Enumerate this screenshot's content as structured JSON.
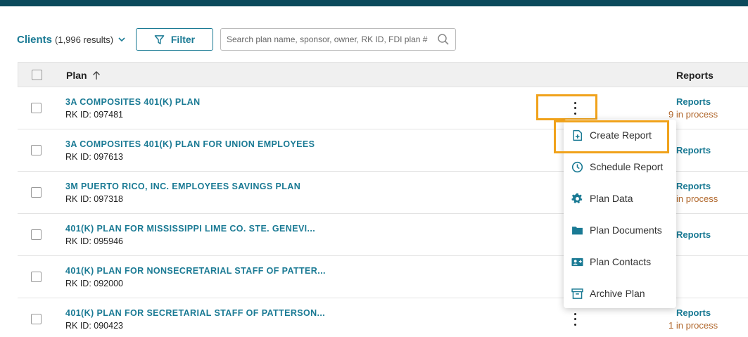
{
  "toolbar": {
    "clients_label": "Clients",
    "clients_count": "(1,996 results)",
    "filter_label": "Filter",
    "search_placeholder": "Search plan name, sponsor, owner, RK ID, FDI plan #",
    "search_value": ""
  },
  "table": {
    "columns": {
      "plan": "Plan",
      "reports": "Reports"
    },
    "rows": [
      {
        "name": "3A COMPOSITES 401(K) PLAN",
        "rk": "RK ID: 097481",
        "reports": "Reports",
        "status": "9 in process"
      },
      {
        "name": "3A COMPOSITES 401(K) PLAN FOR UNION EMPLOYEES",
        "rk": "RK ID: 097613",
        "reports": "Reports",
        "status": ""
      },
      {
        "name": "3M PUERTO RICO, INC. EMPLOYEES SAVINGS PLAN",
        "rk": "RK ID: 097318",
        "reports": "Reports",
        "status": "in process"
      },
      {
        "name": "401(K) PLAN FOR MISSISSIPPI LIME CO. STE. GENEVI...",
        "rk": "RK ID: 095946",
        "reports": "Reports",
        "status": ""
      },
      {
        "name": "401(K) PLAN FOR NONSECRETARIAL STAFF OF PATTER...",
        "rk": "RK ID: 092000",
        "reports": "",
        "status": ""
      },
      {
        "name": "401(K) PLAN FOR SECRETARIAL STAFF OF PATTERSON...",
        "rk": "RK ID: 090423",
        "reports": "Reports",
        "status": "1 in process"
      }
    ]
  },
  "menu": {
    "items": [
      {
        "label": "Create Report",
        "icon": "file-plus-icon"
      },
      {
        "label": "Schedule Report",
        "icon": "clock-icon"
      },
      {
        "label": "Plan Data",
        "icon": "gear-icon"
      },
      {
        "label": "Plan Documents",
        "icon": "folder-icon"
      },
      {
        "label": "Plan Contacts",
        "icon": "contact-card-icon"
      },
      {
        "label": "Archive Plan",
        "icon": "archive-box-icon"
      }
    ]
  },
  "colors": {
    "header_bar": "#0c4a5c",
    "link": "#1a7a94",
    "status": "#b0662a",
    "highlight": "#f0a21b"
  }
}
